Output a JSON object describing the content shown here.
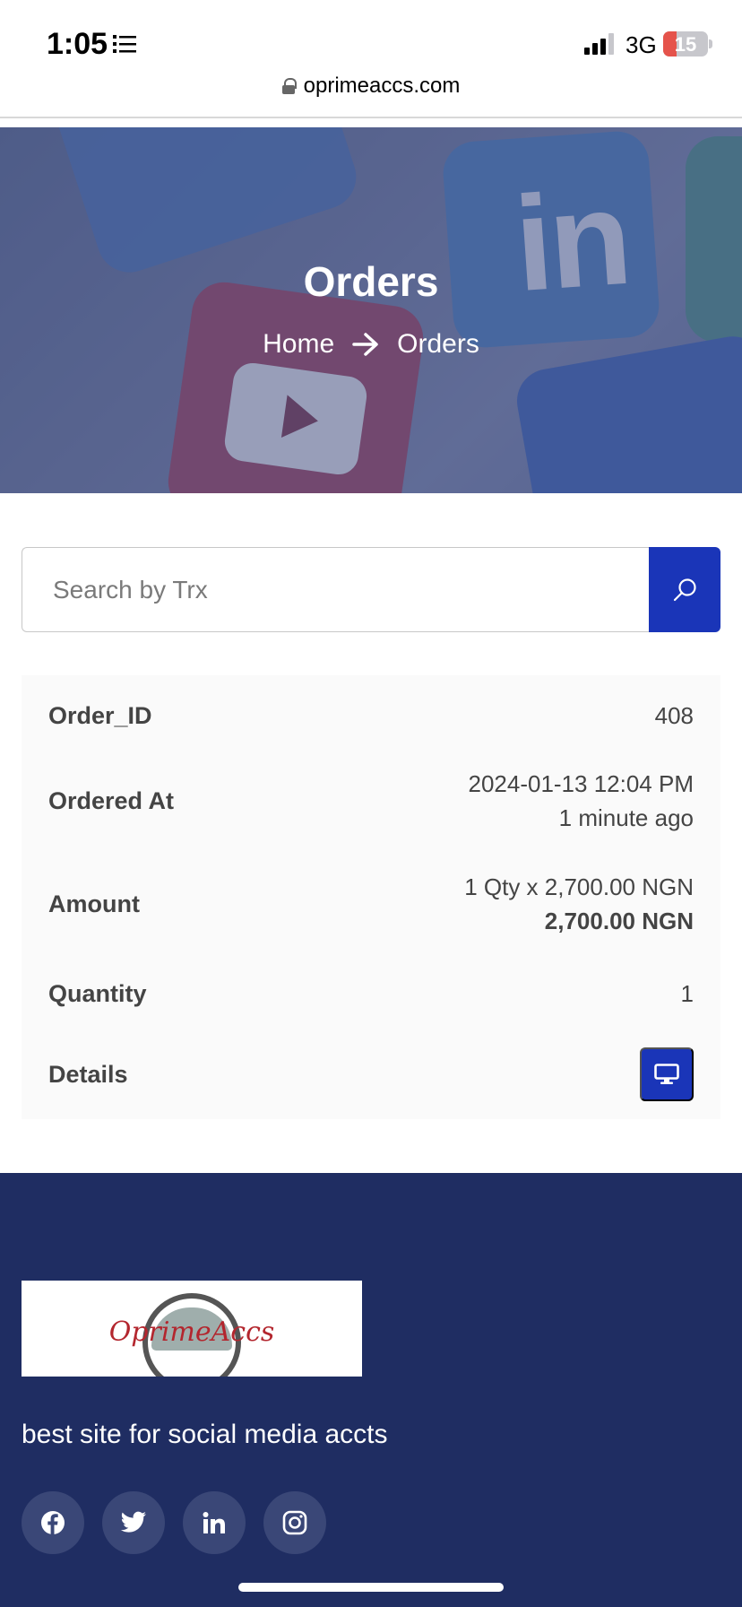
{
  "status_bar": {
    "time": "1:05",
    "network": "3G",
    "battery": "15",
    "battery_level": 0.15
  },
  "browser": {
    "url": "oprimeaccs.com"
  },
  "hero": {
    "title": "Orders",
    "breadcrumb_home": "Home",
    "breadcrumb_current": "Orders"
  },
  "search": {
    "placeholder": "Search by Trx"
  },
  "order": {
    "order_id_label": "Order_ID",
    "order_id": "408",
    "ordered_at_label": "Ordered At",
    "ordered_at": "2024-01-13 12:04 PM",
    "ordered_ago": "1 minute ago",
    "amount_label": "Amount",
    "amount_calc": "1 Qty x 2,700.00 NGN",
    "amount_total": "2,700.00 NGN",
    "quantity_label": "Quantity",
    "quantity": "1",
    "details_label": "Details"
  },
  "footer": {
    "logo_text": "OprimeAccs",
    "tagline": "best site for social media accts",
    "socials": [
      "facebook-icon",
      "twitter-icon",
      "linkedin-icon",
      "instagram-icon"
    ]
  },
  "colors": {
    "accent": "#1a35b8",
    "footer_bg": "#1f2d62",
    "battery_low": "#e5534b"
  }
}
